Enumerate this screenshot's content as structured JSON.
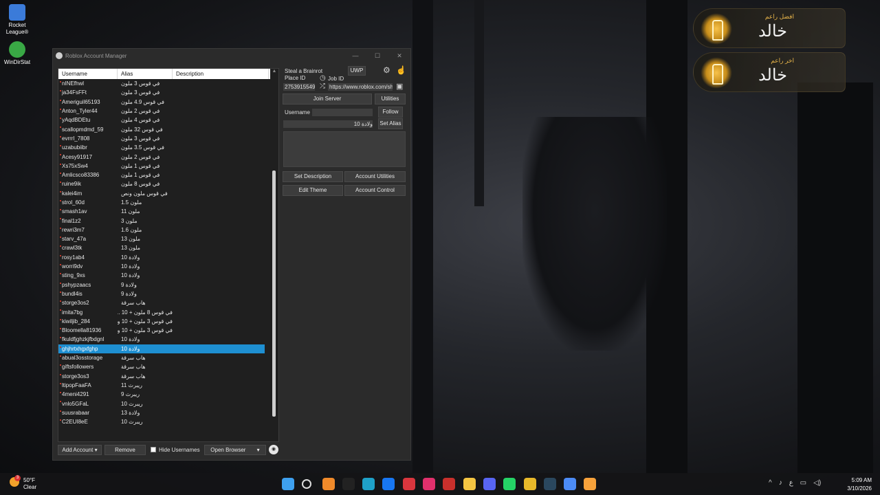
{
  "desktop": {
    "icons": [
      {
        "label": "Rocket League®",
        "color": "#3b7bd9"
      },
      {
        "label": "WinDirStat",
        "color": "#39a845"
      }
    ],
    "widgets": [
      {
        "subtitle": "افضل راعم",
        "name": "خالد"
      },
      {
        "subtitle": "اخر راعم",
        "name": "خالد"
      }
    ]
  },
  "window": {
    "title": "Roblox Account Manager",
    "controls": {
      "minimize": "—",
      "maximize": "☐",
      "close": "✕"
    }
  },
  "accounts": {
    "headers": {
      "username": "Username",
      "alias": "Alias",
      "description": "Description"
    },
    "rows": [
      {
        "u": "nINEfhwl",
        "a": "في قوس 3 ملون"
      },
      {
        "u": "ja34FsFFt",
        "a": "في قوس 3 ملون"
      },
      {
        "u": "Ameriguil65193",
        "a": "في قوس 4.9 ملون"
      },
      {
        "u": "Anton_Tyler44",
        "a": "في قوس 2 ملون"
      },
      {
        "u": "yAqdBDEtu",
        "a": "في قوس 4 ملون"
      },
      {
        "u": "scallopmdmd_59",
        "a": "في قوس 32 ملون"
      },
      {
        "u": "evrrrl_7808",
        "a": "في قوس 3 ملون"
      },
      {
        "u": "uzabubiibr",
        "a": "في قوس 3.5 ملون"
      },
      {
        "u": "Acesy91917",
        "a": "في قوس 2 ملون"
      },
      {
        "u": "Xs75xSw4",
        "a": "في قوس 1 ملون"
      },
      {
        "u": "Amlicsco83386",
        "a": "في قوس 1 ملون"
      },
      {
        "u": "ruine9ik",
        "a": "في قوس 8 ملون"
      },
      {
        "u": "kalei4im",
        "a": "في قوس ملون ونص"
      },
      {
        "u": "strol_60d",
        "a": "ملون 1.5"
      },
      {
        "u": "smash1av",
        "a": "ملون 11"
      },
      {
        "u": "final1z2",
        "a": "ملون 3"
      },
      {
        "u": "rewri3m7",
        "a": "ملون 1.6"
      },
      {
        "u": "starv_47a",
        "a": "ملون 13"
      },
      {
        "u": "crawl3tk",
        "a": "ملون 13"
      },
      {
        "u": "rosy1ab4",
        "a": "ولادة 10"
      },
      {
        "u": "worri9dv",
        "a": "ولادة 10"
      },
      {
        "u": "sting_9xs",
        "a": "ولادة 10"
      },
      {
        "u": "pshypzaacs",
        "a": "ولادة 9"
      },
      {
        "u": "bundl4is",
        "a": "ولادة 9"
      },
      {
        "u": "storge3os2",
        "a": "هاب سرقة"
      },
      {
        "u": "imita7bg",
        "a": "في قوس 8 ملون + 10 ..."
      },
      {
        "u": "kiwiljib_284",
        "a": "في قوس 3 ملون + 10 و..."
      },
      {
        "u": "Bloomella81936",
        "a": "في قوس 3 ملون + 10 و..."
      },
      {
        "u": "fkuldfjghzkjfbdgnl",
        "a": "ولادة 10"
      },
      {
        "u": "ghjhrtxhgxfghp",
        "a": "ولادة 10"
      },
      {
        "u": "abual3osstorage",
        "a": "هاب سرقة"
      },
      {
        "u": "giftsfollowers",
        "a": "هاب سرقة"
      },
      {
        "u": "storge3os3",
        "a": "هاب سرقة"
      },
      {
        "u": "ltipopFaaFA",
        "a": "ريبرث 11"
      },
      {
        "u": "4meni4291",
        "a": "ريبرث 9"
      },
      {
        "u": "vnlo5GFaL",
        "a": "ريبرث 10"
      },
      {
        "u": "suusrabaar",
        "a": "ولادة 13"
      },
      {
        "u": "C2EUI8eE",
        "a": "ريبرث 10"
      }
    ],
    "selected_index": 29
  },
  "panel": {
    "game_name": "Steal a Brainrot",
    "platform": "UWP",
    "place_id_label": "Place ID",
    "job_id_label": "Job ID",
    "place_id_value": "2753915549",
    "job_id_value": "https://www.roblox.com/sha",
    "join_server": "Join Server",
    "utilities": "Utilities",
    "username_label": "Username",
    "username_value": "",
    "follow": "Follow",
    "alias_value": "ولادة 10",
    "set_alias": "Set Alias",
    "set_description": "Set Description",
    "account_utilities": "Account Utilities",
    "edit_theme": "Edit Theme",
    "account_control": "Account Control"
  },
  "bottom_bar": {
    "add_account": "Add Account",
    "remove": "Remove",
    "hide_usernames": "Hide Usernames",
    "open_browser": "Open Browser"
  },
  "taskbar": {
    "weather_temp": "50°F",
    "weather_desc": "Clear",
    "weather_badge": "3",
    "input_lang": "ع",
    "time": "5:09 AM",
    "date": "3/10/2026",
    "apps": [
      {
        "name": "windows-start-icon",
        "color": "#3ea0ef"
      },
      {
        "name": "search-icon",
        "color": "transparent"
      },
      {
        "name": "cloud-app-icon",
        "color": "#f08a2a"
      },
      {
        "name": "dark-app-icon",
        "color": "#222"
      },
      {
        "name": "edge-icon",
        "color": "#1fa1c8"
      },
      {
        "name": "facebook-icon",
        "color": "#1877f2"
      },
      {
        "name": "red-app-icon",
        "color": "#d9363e"
      },
      {
        "name": "instagram-icon",
        "color": "#e1306c"
      },
      {
        "name": "acrobat-icon",
        "color": "#c9302c"
      },
      {
        "name": "file-explorer-icon",
        "color": "#f4c542"
      },
      {
        "name": "discord-icon",
        "color": "#5865f2"
      },
      {
        "name": "whatsapp-icon",
        "color": "#25d366"
      },
      {
        "name": "chrome-icon",
        "color": "#e8b92a"
      },
      {
        "name": "steam-icon",
        "color": "#2a475e"
      },
      {
        "name": "chrome-active-icon",
        "color": "#4c8bf5"
      },
      {
        "name": "orange-app-icon",
        "color": "#f7a23b"
      }
    ]
  }
}
